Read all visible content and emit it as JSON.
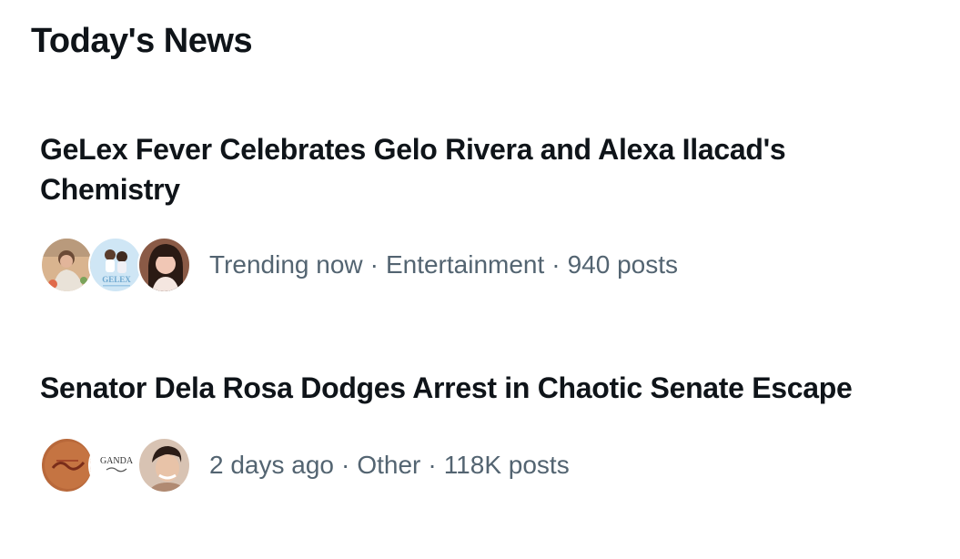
{
  "section": {
    "title": "Today's News"
  },
  "news": [
    {
      "headline": "GeLex Fever Celebrates Gelo Rivera and Alexa Ilacad's Chemistry",
      "status": "Trending now",
      "category": "Entertainment",
      "posts": "940 posts",
      "avatars": [
        {
          "icon": "person-photo-avatar",
          "bg": "#d9b48f"
        },
        {
          "icon": "gelex-fanpage-avatar",
          "bg": "#cfe6f5",
          "text": "GELEX"
        },
        {
          "icon": "person-photo-avatar",
          "bg": "#8a5a46"
        }
      ]
    },
    {
      "headline": "Senator Dela Rosa Dodges Arrest in Chaotic Senate Escape",
      "status": "2 days ago",
      "category": "Other",
      "posts": "118K posts",
      "avatars": [
        {
          "icon": "news-outlet-logo-avatar",
          "bg": "#b8683a"
        },
        {
          "icon": "ganda-logo-avatar",
          "bg": "#ffffff",
          "text": "GANDA"
        },
        {
          "icon": "person-photo-avatar",
          "bg": "#c9a58a"
        }
      ]
    }
  ],
  "separator": "·"
}
